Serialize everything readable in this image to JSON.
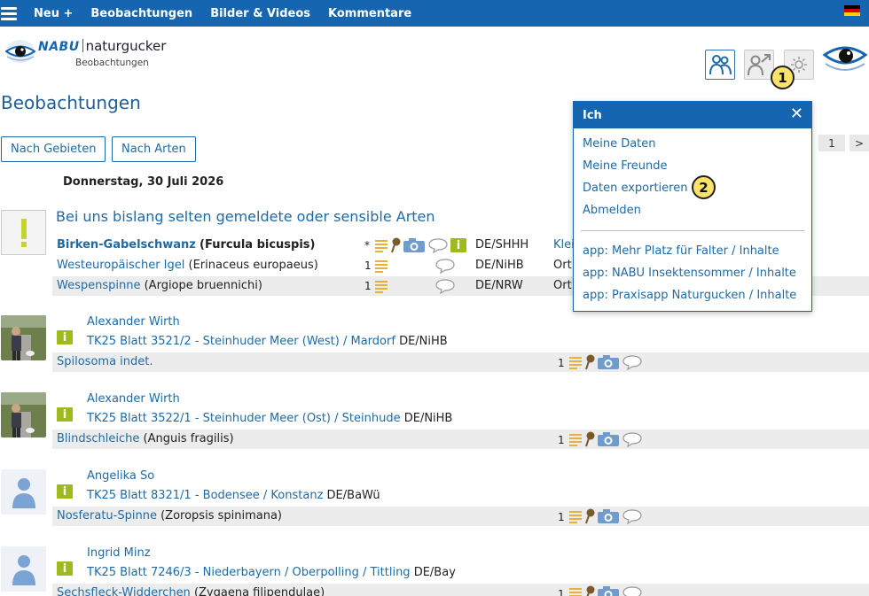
{
  "nav": {
    "items": [
      "Neu +",
      "Beobachtungen",
      "Bilder & Videos",
      "Kommentare"
    ],
    "flag_colors": [
      "#000000",
      "#dd0000",
      "#ffce00"
    ]
  },
  "logo": {
    "brand_bold": "NABU",
    "brand_rest": "naturgucker",
    "subtitle": "Beobachtungen",
    "icon": "eye-logo-icon"
  },
  "header_buttons": {
    "friends_icon": "people-icon",
    "user_export_icon": "user-arrow-icon",
    "settings_icon": "gear-icon",
    "marker1": "1",
    "marker2": "2"
  },
  "page": {
    "title": "Beobachtungen",
    "by_area": "Nach Gebieten",
    "by_species": "Nach Arten",
    "pager_page": "1",
    "pager_next": ">",
    "date": "Donnerstag, 30 Juli 2026"
  },
  "rare": {
    "heading": "Bei uns bislang selten gemeldete oder sensible Arten",
    "rows": [
      {
        "common": "Birken-Gabelschwanz",
        "latin": "(Furcula bicuspis)",
        "count": "*",
        "region": "DE/SHHH",
        "place": "Klei",
        "bold": true
      },
      {
        "common": "Westeuropäischer Igel",
        "latin": "(Erinaceus europaeus)",
        "count": "1",
        "region": "DE/NiHB",
        "place": "Ort",
        "bold": false
      },
      {
        "common": "Wespenspinne",
        "latin": "(Argiope bruennichi)",
        "count": "1",
        "region": "DE/NRW",
        "place": "Ort",
        "bold": false
      }
    ]
  },
  "observations": [
    {
      "observer": "Alexander Wirth",
      "location": "TK25 Blatt 3521/2 - Steinhuder Meer (West) / Mardorf",
      "region": "DE/NiHB",
      "species": "Spilosoma indet.",
      "latin": "",
      "count": "1"
    },
    {
      "observer": "Alexander Wirth",
      "location": "TK25 Blatt 3522/1 - Steinhuder Meer (Ost) / Steinhude",
      "region": "DE/NiHB",
      "species": "Blindschleiche",
      "latin": "(Anguis fragilis)",
      "count": "1"
    },
    {
      "observer": "Angelika So",
      "location": "TK25 Blatt 8321/1 - Bodensee / Konstanz",
      "region": "DE/BaWü",
      "species": "Nosferatu-Spinne",
      "latin": "(Zoropsis spinimana)",
      "count": "1"
    },
    {
      "observer": "Ingrid Minz",
      "location": "TK25 Blatt 7246/3 - Niederbayern / Oberpolling / Tittling",
      "region": "DE/Bay",
      "species": "Sechsfleck-Widderchen",
      "latin": "(Zygaena filipendulae)",
      "count": "1"
    }
  ],
  "dropdown": {
    "title": "Ich",
    "close": "✕",
    "items": [
      "Meine Daten",
      "Meine Freunde",
      "Daten exportieren",
      "Abmelden"
    ],
    "apps": [
      "app: Mehr Platz für Falter / Inhalte",
      "app: NABU Insektensommer / Inhalte",
      "app: Praxisapp Naturgucken / Inhalte"
    ]
  },
  "colors": {
    "brand_blue": "#1565b0",
    "link_blue": "#1f6aa5",
    "info_green": "#9dbb1f",
    "list_icon_yellow": "#e8b13a",
    "camera_blue": "#6f9ccc"
  }
}
